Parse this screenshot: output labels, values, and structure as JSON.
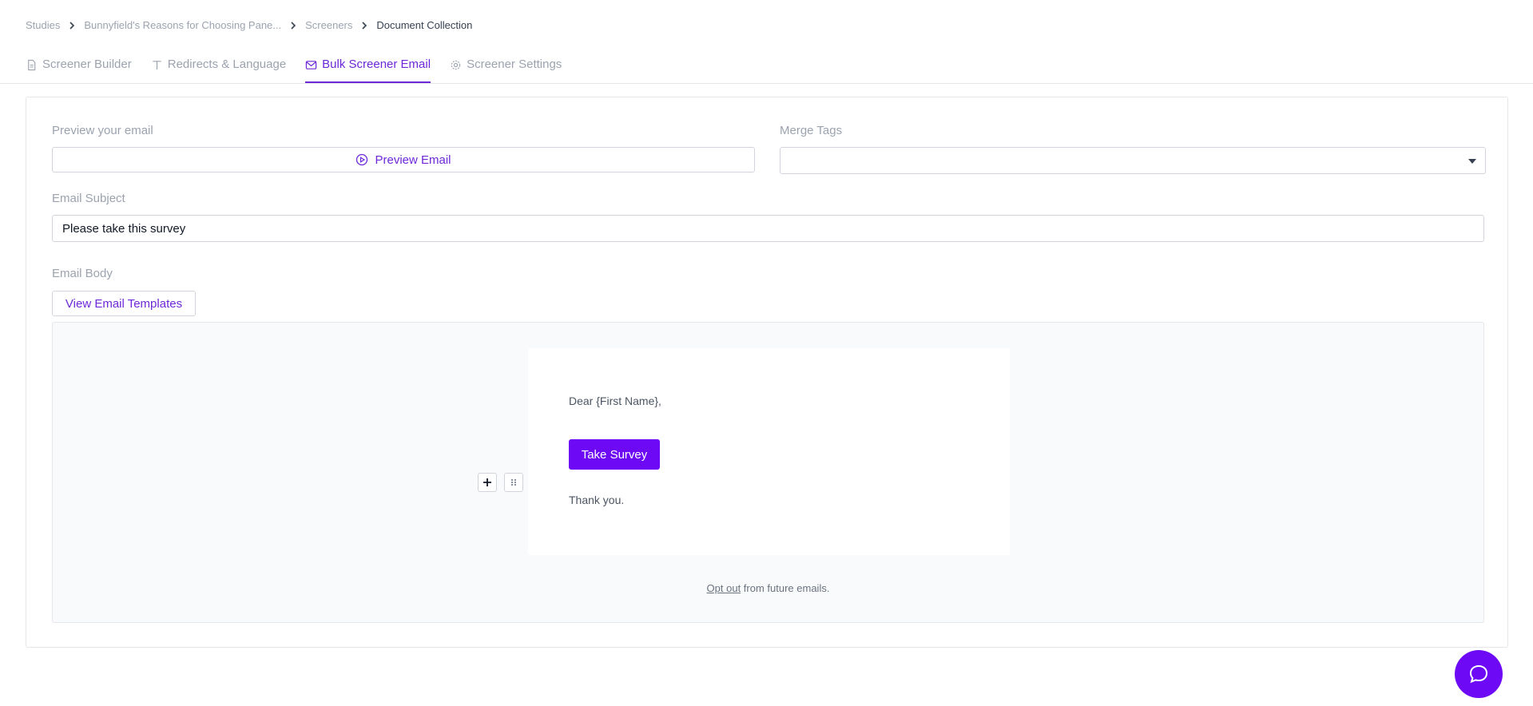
{
  "breadcrumb": {
    "items": [
      "Studies",
      "Bunnyfield's Reasons for Choosing Pane...",
      "Screeners",
      "Document Collection"
    ]
  },
  "tabs": [
    {
      "label": "Screener Builder",
      "icon": "document-icon",
      "active": false
    },
    {
      "label": "Redirects & Language",
      "icon": "text-icon",
      "active": false
    },
    {
      "label": "Bulk Screener Email",
      "icon": "mail-icon",
      "active": true
    },
    {
      "label": "Screener Settings",
      "icon": "gear-icon",
      "active": false
    }
  ],
  "form": {
    "preview_label": "Preview your email",
    "preview_button": "Preview Email",
    "merge_tags_label": "Merge Tags",
    "merge_tags_value": "",
    "subject_label": "Email Subject",
    "subject_value": "Please take this survey",
    "body_label": "Email Body",
    "templates_button": "View Email Templates"
  },
  "email": {
    "greeting": "Dear {First Name},",
    "cta_button": "Take Survey",
    "closing": "Thank you.",
    "optout_link": "Opt out",
    "optout_suffix": " from future emails."
  },
  "colors": {
    "accent": "#6d28d9",
    "button": "#6d09f5"
  }
}
